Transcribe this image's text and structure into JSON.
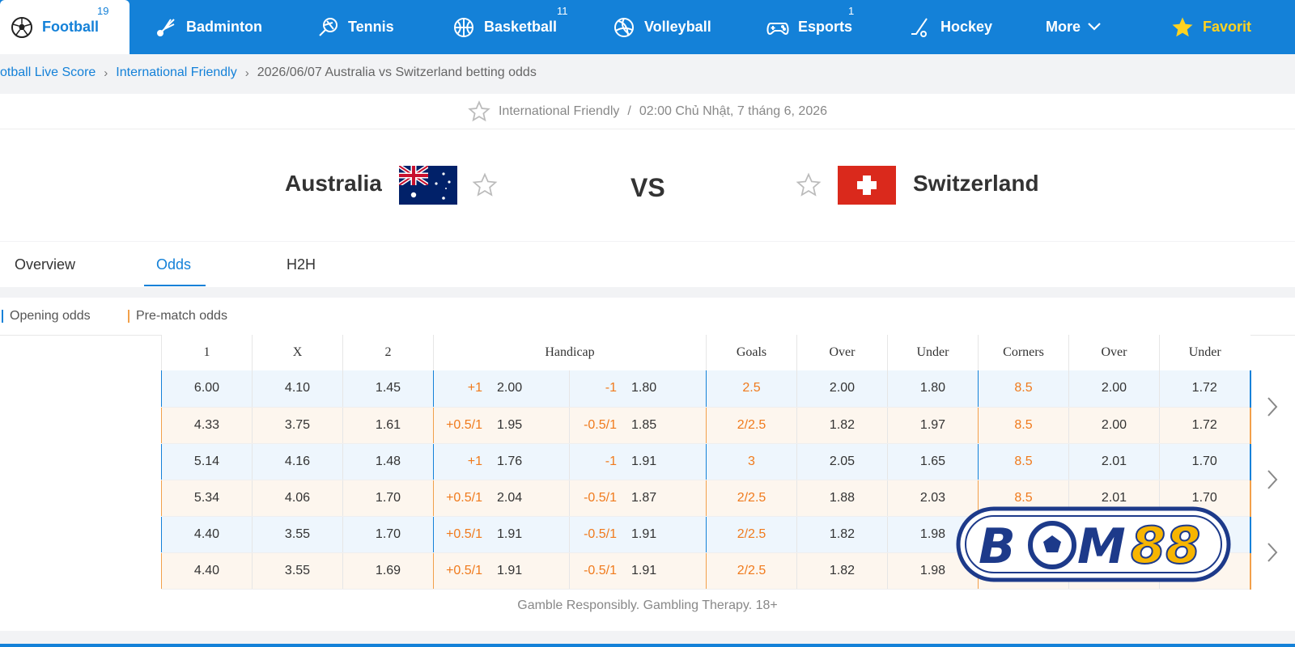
{
  "nav": {
    "tabs": [
      {
        "label": "Football",
        "count": "19",
        "icon": "football-icon",
        "active": true
      },
      {
        "label": "Badminton",
        "count": "",
        "icon": "shuttlecock-icon"
      },
      {
        "label": "Tennis",
        "count": "",
        "icon": "tennis-racket-icon"
      },
      {
        "label": "Basketball",
        "count": "11",
        "icon": "basketball-icon"
      },
      {
        "label": "Volleyball",
        "count": "",
        "icon": "volleyball-icon"
      },
      {
        "label": "Esports",
        "count": "1",
        "icon": "gamepad-icon"
      },
      {
        "label": "Hockey",
        "count": "",
        "icon": "hockey-stick-icon"
      },
      {
        "label": "More",
        "icon": "chevron-down-icon"
      },
      {
        "label": "Favorit",
        "icon": "star-icon"
      }
    ]
  },
  "breadcrumb": {
    "items": [
      "otball Live Score",
      "International Friendly"
    ],
    "current": "2026/06/07 Australia vs Switzerland betting odds"
  },
  "match": {
    "league": "International Friendly",
    "datetime": "02:00 Chủ Nhật, 7 tháng 6, 2026",
    "home": "Australia",
    "away": "Switzerland",
    "vs": "VS"
  },
  "tabs": [
    "Overview",
    "Odds",
    "H2H"
  ],
  "active_tab": "Odds",
  "legend": {
    "opening": "Opening odds",
    "prematch": "Pre-match odds",
    "opening_color": "#1481d8",
    "prematch_color": "#f2a04a"
  },
  "odds_table": {
    "headers": [
      "1",
      "X",
      "2",
      "Handicap",
      "Goals",
      "Over",
      "Under",
      "Corners",
      "Over",
      "Under"
    ],
    "rows": [
      {
        "type": "open",
        "c1": "6.00",
        "cx": "4.10",
        "c2": "1.45",
        "h_home": "+1",
        "h_home_odds": "2.00",
        "h_away": "-1",
        "h_away_odds": "1.80",
        "goals": "2.5",
        "g_over": "2.00",
        "g_under": "1.80",
        "corners": "8.5",
        "c_over": "2.00",
        "c_under": "1.72"
      },
      {
        "type": "pre",
        "c1": "4.33",
        "cx": "3.75",
        "c2": "1.61",
        "h_home": "+0.5/1",
        "h_home_odds": "1.95",
        "h_away": "-0.5/1",
        "h_away_odds": "1.85",
        "goals": "2/2.5",
        "g_over": "1.82",
        "g_under": "1.97",
        "corners": "8.5",
        "c_over": "2.00",
        "c_under": "1.72"
      },
      {
        "type": "open",
        "c1": "5.14",
        "cx": "4.16",
        "c2": "1.48",
        "h_home": "+1",
        "h_home_odds": "1.76",
        "h_away": "-1",
        "h_away_odds": "1.91",
        "goals": "3",
        "g_over": "2.05",
        "g_under": "1.65",
        "corners": "8.5",
        "c_over": "2.01",
        "c_under": "1.70"
      },
      {
        "type": "pre",
        "c1": "5.34",
        "cx": "4.06",
        "c2": "1.70",
        "h_home": "+0.5/1",
        "h_home_odds": "2.04",
        "h_away": "-0.5/1",
        "h_away_odds": "1.87",
        "goals": "2/2.5",
        "g_over": "1.88",
        "g_under": "2.03",
        "corners": "8.5",
        "c_over": "2.01",
        "c_under": "1.70"
      },
      {
        "type": "open",
        "c1": "4.40",
        "cx": "3.55",
        "c2": "1.70",
        "h_home": "+0.5/1",
        "h_home_odds": "1.91",
        "h_away": "-0.5/1",
        "h_away_odds": "1.91",
        "goals": "2/2.5",
        "g_over": "1.82",
        "g_under": "1.98",
        "corners": "",
        "c_over": "",
        "c_under": ""
      },
      {
        "type": "pre",
        "c1": "4.40",
        "cx": "3.55",
        "c2": "1.69",
        "h_home": "+0.5/1",
        "h_home_odds": "1.91",
        "h_away": "-0.5/1",
        "h_away_odds": "1.91",
        "goals": "2/2.5",
        "g_over": "1.82",
        "g_under": "1.98",
        "corners": "",
        "c_over": "",
        "c_under": ""
      }
    ]
  },
  "disclaimer": "Gamble Responsibly. Gambling Therapy. 18+",
  "logo_text": "BOM88",
  "colors": {
    "brand": "#1481d8",
    "accent_orange": "#f07a1c",
    "logo_navy": "#1d3a8a",
    "logo_yellow": "#f7b500"
  }
}
